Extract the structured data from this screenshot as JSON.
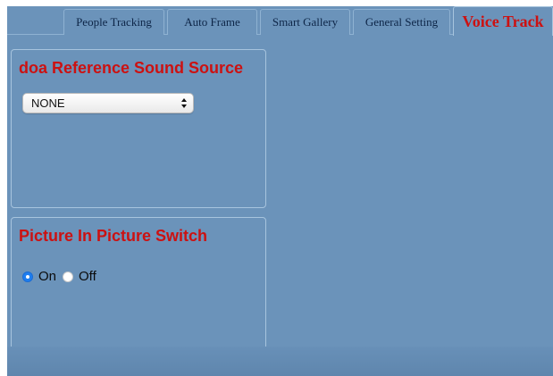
{
  "tabs": [
    {
      "label": "People Tracking",
      "active": false
    },
    {
      "label": "Auto Frame",
      "active": false
    },
    {
      "label": "Smart Gallery",
      "active": false
    },
    {
      "label": "General Setting",
      "active": false
    },
    {
      "label": "Voice Track",
      "active": true
    }
  ],
  "doa_panel": {
    "title": "doa Reference Sound Source",
    "select_value": "NONE"
  },
  "pip_panel": {
    "title": "Picture In Picture Switch",
    "options": [
      {
        "label": "On",
        "checked": true
      },
      {
        "label": "Off",
        "checked": false
      }
    ]
  },
  "colors": {
    "background": "#6b93ba",
    "accent_title": "#cc1111",
    "tab_text": "#0d2547",
    "radio_checked": "#1e7ef0"
  }
}
